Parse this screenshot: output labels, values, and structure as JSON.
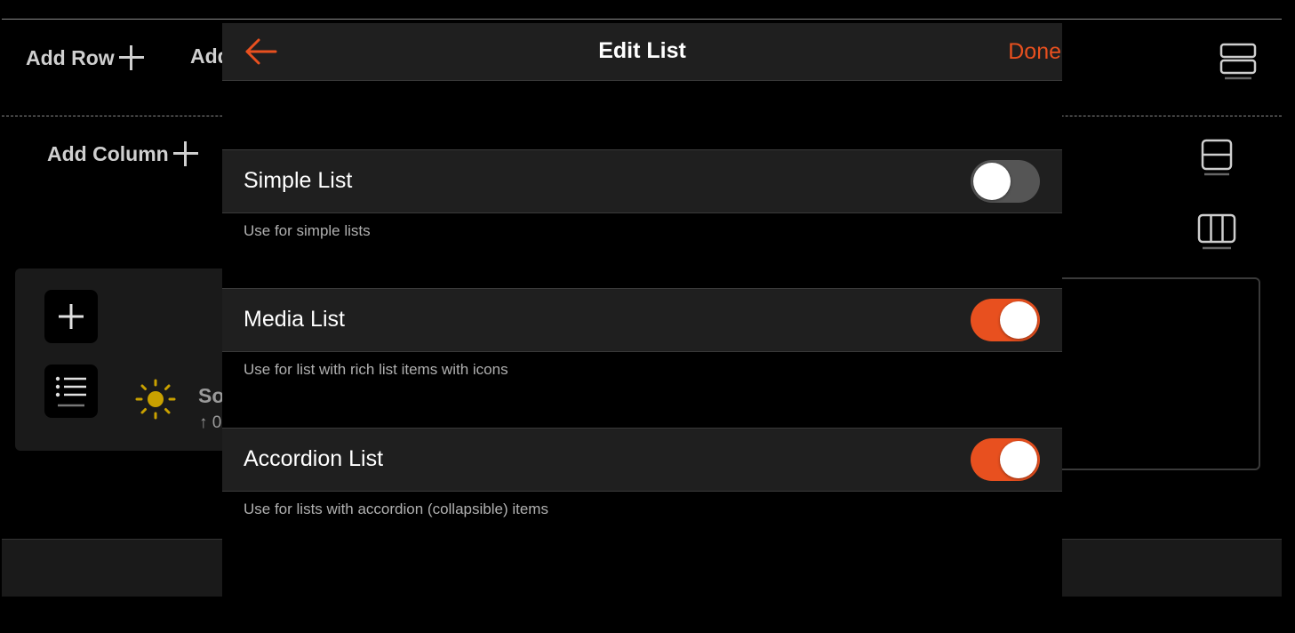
{
  "background": {
    "add_row_label": "Add Row",
    "add_truncated_label": "Add",
    "add_column_label": "Add Column",
    "item_title_truncated": "So",
    "item_subtitle_truncated": "↑ 0"
  },
  "modal": {
    "title": "Edit List",
    "done_label": "Done",
    "accent_color": "#e8501f",
    "options": [
      {
        "label": "Simple List",
        "description": "Use for simple lists",
        "enabled": false
      },
      {
        "label": "Media List",
        "description": "Use for list with rich list items with icons",
        "enabled": true
      },
      {
        "label": "Accordion List",
        "description": "Use for lists with accordion (collapsible) items",
        "enabled": true
      }
    ]
  },
  "icons": {
    "back": "arrow-left-icon",
    "rows_layout": "rows-layout-icon",
    "split_layout": "split-layout-icon",
    "columns_layout": "columns-layout-icon",
    "add": "plus-icon",
    "list": "list-icon",
    "sun": "sun-icon"
  }
}
